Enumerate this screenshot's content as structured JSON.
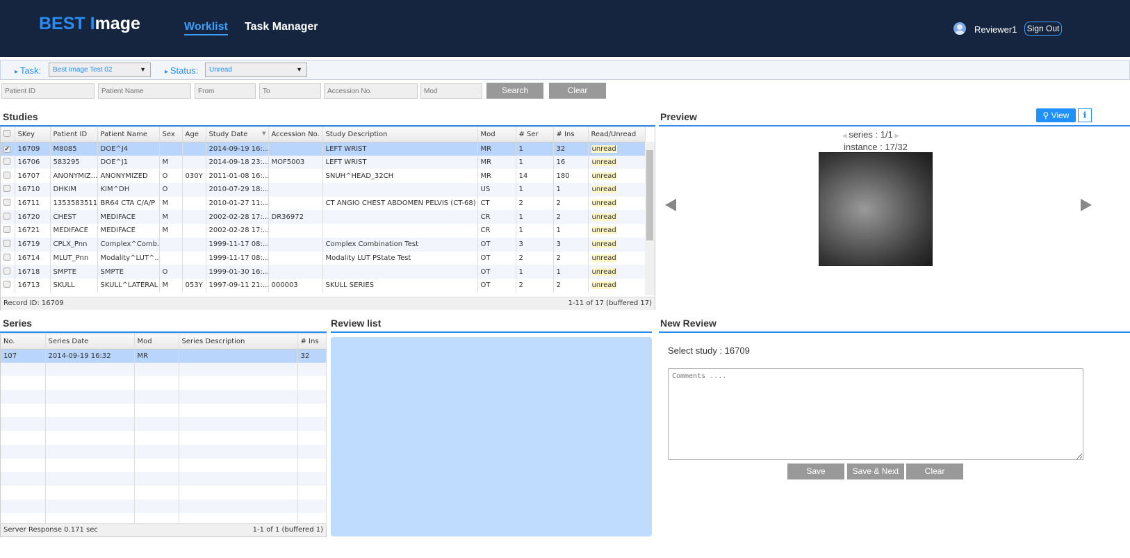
{
  "header": {
    "logo_a": "BEST I",
    "logo_b": "mage",
    "nav": [
      "Worklist",
      "Task Manager"
    ],
    "user": "Reviewer1",
    "signout": "Sign Out"
  },
  "filters": {
    "task_label": "Task:",
    "task_value": "Best Image Test 02",
    "status_label": "Status:",
    "status_value": "Unread"
  },
  "search": {
    "placeholders": [
      "Patient ID",
      "Patient Name",
      "From",
      "To",
      "Accession No.",
      "Mod"
    ],
    "search_btn": "Search",
    "clear_btn": "Clear"
  },
  "studies": {
    "title": "Studies",
    "columns": [
      "",
      "SKey",
      "Patient ID",
      "Patient Name",
      "Sex",
      "Age",
      "Study Date",
      "Accession No.",
      "Study Description",
      "Mod",
      "# Ser",
      "# Ins",
      "Read/Unread"
    ],
    "rows": [
      [
        "16709",
        "M8085",
        "DOE^J4",
        "",
        "",
        "2014-09-19 16:...",
        "",
        "LEFT WRIST",
        "MR",
        "1",
        "32",
        "unread"
      ],
      [
        "16706",
        "583295",
        "DOE^J1",
        "M",
        "",
        "2014-09-18 23:...",
        "MOF5003",
        "LEFT WRIST",
        "MR",
        "1",
        "16",
        "unread"
      ],
      [
        "16707",
        "ANONYMIZ...",
        "ANONYMIZED",
        "O",
        "030Y",
        "2011-01-08 16:...",
        "",
        "SNUH^HEAD_32CH",
        "MR",
        "14",
        "180",
        "unread"
      ],
      [
        "16710",
        "DHKIM",
        "KIM^DH",
        "O",
        "",
        "2010-07-29 18:...",
        "",
        "",
        "US",
        "1",
        "1",
        "unread"
      ],
      [
        "16711",
        "1353583511",
        "BR64 CTA C/A/P",
        "M",
        "",
        "2010-01-27 11:...",
        "",
        "CT ANGIO CHEST ABDOMEN PELVIS (CT-68)",
        "CT",
        "2",
        "2",
        "unread"
      ],
      [
        "16720",
        "CHEST",
        "MEDIFACE",
        "M",
        "",
        "2002-02-28 17:...",
        "DR36972",
        "",
        "CR",
        "1",
        "2",
        "unread"
      ],
      [
        "16721",
        "MEDIFACE",
        "MEDIFACE",
        "M",
        "",
        "2002-02-28 17:...",
        "",
        "",
        "CR",
        "1",
        "1",
        "unread"
      ],
      [
        "16719",
        "CPLX_Pnn",
        "Complex^Comb...",
        "",
        "",
        "1999-11-17 08:...",
        "",
        "Complex Combination Test",
        "OT",
        "3",
        "3",
        "unread"
      ],
      [
        "16714",
        "MLUT_Pnn",
        "Modality^LUT^...",
        "",
        "",
        "1999-11-17 08:...",
        "",
        "Modality LUT PState Test",
        "OT",
        "2",
        "2",
        "unread"
      ],
      [
        "16718",
        "SMPTE",
        "SMPTE",
        "O",
        "",
        "1999-01-30 16:...",
        "",
        "",
        "OT",
        "1",
        "1",
        "unread"
      ],
      [
        "16713",
        "SKULL",
        "SKULL^LATERAL",
        "M",
        "053Y",
        "1997-09-11 21:...",
        "000003",
        "SKULL SERIES",
        "OT",
        "2",
        "2",
        "unread"
      ]
    ],
    "record_id": "Record ID: 16709",
    "paging": "1-11 of 17 (buffered 17)"
  },
  "preview": {
    "title": "Preview",
    "view_btn": "View",
    "series": "series : 1/1",
    "instance": "instance : 17/32"
  },
  "series": {
    "title": "Series",
    "columns": [
      "No.",
      "Series Date",
      "Mod",
      "Series Description",
      "# Ins"
    ],
    "rows": [
      [
        "107",
        "2014-09-19 16:32",
        "MR",
        "",
        "32"
      ]
    ],
    "server": "Server Response 0.171 sec",
    "paging": "1-1 of 1 (buffered 1)"
  },
  "review_list": {
    "title": "Review list"
  },
  "new_review": {
    "title": "New Review",
    "select_study": "Select study : 16709",
    "comments_placeholder": "Comments ....",
    "save": "Save",
    "save_next": "Save & Next",
    "clear": "Clear"
  }
}
